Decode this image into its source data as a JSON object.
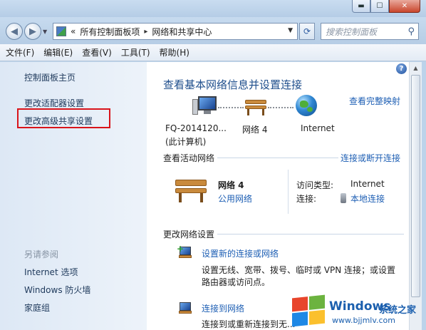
{
  "window": {
    "minimize_glyph": "▬",
    "maximize_glyph": "☐",
    "close_glyph": "✕"
  },
  "address_bar": {
    "prefix": "«",
    "path": [
      "所有控制面板项",
      "网络和共享中心"
    ],
    "separator": "▸",
    "search_placeholder": "搜索控制面板"
  },
  "menu": [
    "文件(F)",
    "编辑(E)",
    "查看(V)",
    "工具(T)",
    "帮助(H)"
  ],
  "left_pane": {
    "links": [
      "控制面板主页",
      "更改适配器设置",
      "更改高级共享设置"
    ],
    "highlighted_item": "更改高级共享设置",
    "highlight_color": "#d9141a",
    "see_also_title": "另请参阅",
    "see_also": [
      "Internet 选项",
      "Windows 防火墙",
      "家庭组"
    ]
  },
  "main": {
    "title": "查看基本网络信息并设置连接",
    "view_full_map": "查看完整映射",
    "map": {
      "computer_name": "FQ-2014120...",
      "computer_sub": "(此计算机)",
      "network_name": "网络  4",
      "internet_label": "Internet"
    },
    "active_networks": {
      "title": "查看活动网络",
      "connect_link": "连接或断开连接",
      "network_name": "网络  4",
      "network_type": "公用网络",
      "access_type_label": "访问类型:",
      "access_type_value": "Internet",
      "connections_label": "连接:",
      "connections_value": "本地连接"
    },
    "change_settings": {
      "title": "更改网络设置",
      "items": [
        {
          "link": "设置新的连接或网络",
          "desc1": "设置无线、宽带、拨号、临时或 VPN 连接；或设置",
          "desc2": "路由器或访问点。"
        },
        {
          "link": "连接到网络",
          "desc1": "连接到或重新连接到无..."
        }
      ]
    }
  },
  "watermark": {
    "brand": "Windows",
    "brand_cn": "系统之家",
    "url": "www.bjjmlv.com",
    "logo_colors": [
      "#e8452c",
      "#6cb33f",
      "#1e88e5",
      "#fbc02d"
    ]
  }
}
